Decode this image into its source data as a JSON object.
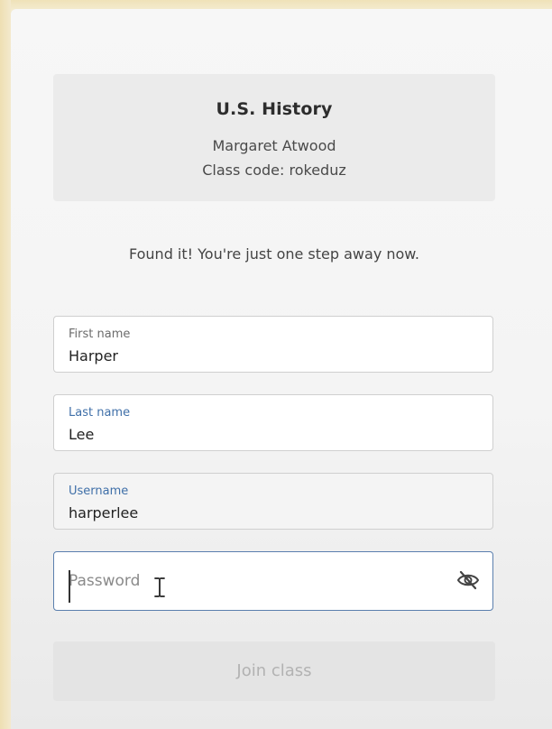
{
  "class_card": {
    "title": "U.S. History",
    "teacher": "Margaret Atwood",
    "class_code_line": "Class code: rokeduz"
  },
  "status_message": "Found it! You're just one step away now.",
  "form": {
    "first_name": {
      "label": "First name",
      "value": "Harper"
    },
    "last_name": {
      "label": "Last name",
      "value": "Lee"
    },
    "username": {
      "label": "Username",
      "value": "harperlee"
    },
    "password": {
      "placeholder": "Password",
      "value": ""
    }
  },
  "icons": {
    "password_toggle": "eye-slash-icon",
    "cursor": "text-cursor-icon"
  },
  "join_button": {
    "label": "Join class",
    "disabled": true
  },
  "colors": {
    "accent_label": "#3f6fa8",
    "focus_border": "#5b7fae",
    "disabled_button_bg": "#e4e4e4",
    "disabled_button_text": "#b2b2b2",
    "frame": "#f3ead0"
  }
}
